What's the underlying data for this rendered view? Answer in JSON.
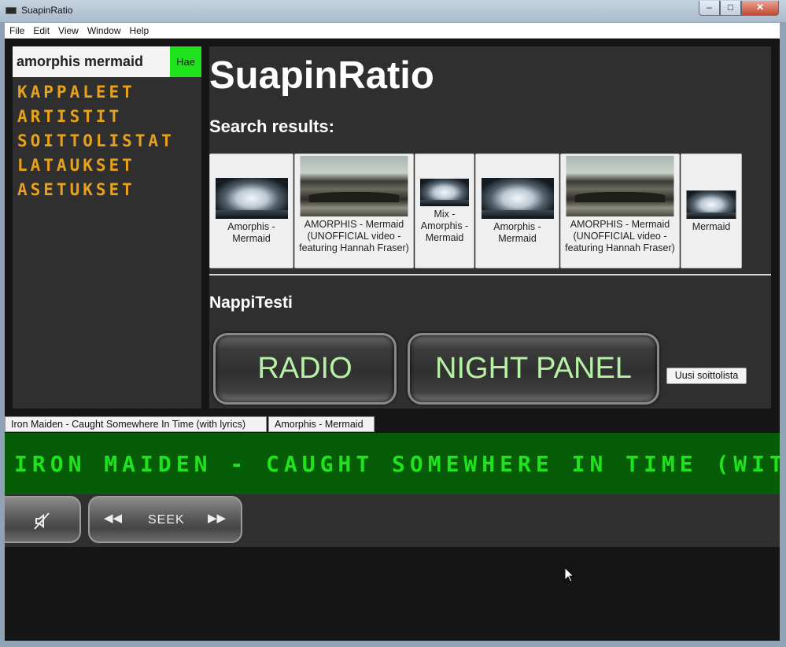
{
  "window": {
    "title": "SuapinRatio"
  },
  "menu": [
    "File",
    "Edit",
    "View",
    "Window",
    "Help"
  ],
  "sidebar": {
    "search_value": "amorphis mermaid",
    "search_button": "Hae",
    "nav": [
      "KAPPALEET",
      "ARTISTIT",
      "SOITTOLISTAT",
      "LATAUKSET",
      "ASETUKSET"
    ]
  },
  "main": {
    "title": "SuapinRatio",
    "results_heading": "Search results:",
    "results": [
      {
        "caption": "Amorphis - Mermaid",
        "thumb": "egg"
      },
      {
        "caption": "AMORPHIS - Mermaid (UNOFFICIAL video - featuring Hannah Fraser)",
        "thumb": "boat"
      },
      {
        "caption": "Mix - Amorphis - Mermaid",
        "thumb": "egg"
      },
      {
        "caption": "Amorphis - Mermaid",
        "thumb": "egg"
      },
      {
        "caption": "AMORPHIS - Mermaid (UNOFFICIAL video - featuring Hannah Fraser)",
        "thumb": "boat"
      },
      {
        "caption": "Mermaid",
        "thumb": "egg"
      }
    ],
    "section_heading": "NappiTesti",
    "radio_button": "RADIO",
    "night_panel_button": "NIGHT PANEL",
    "new_playlist_button": "Uusi soittolista"
  },
  "tabs": [
    "Iron Maiden - Caught Somewhere In Time (with lyrics)",
    "Amorphis - Mermaid"
  ],
  "now_playing": "IRON MAIDEN - CAUGHT SOMEWHERE IN TIME (WITH LYRICS)",
  "transport": {
    "mute_icon": "speaker-muted-icon",
    "seek_label": "SEEK",
    "rewind_symbol": "◀◀",
    "forward_symbol": "▶▶"
  },
  "colors": {
    "accent_green": "#1fe31c",
    "nav_orange": "#e8a11a",
    "marquee_bg": "#075d07",
    "panel_bg": "#2f2f2f"
  }
}
